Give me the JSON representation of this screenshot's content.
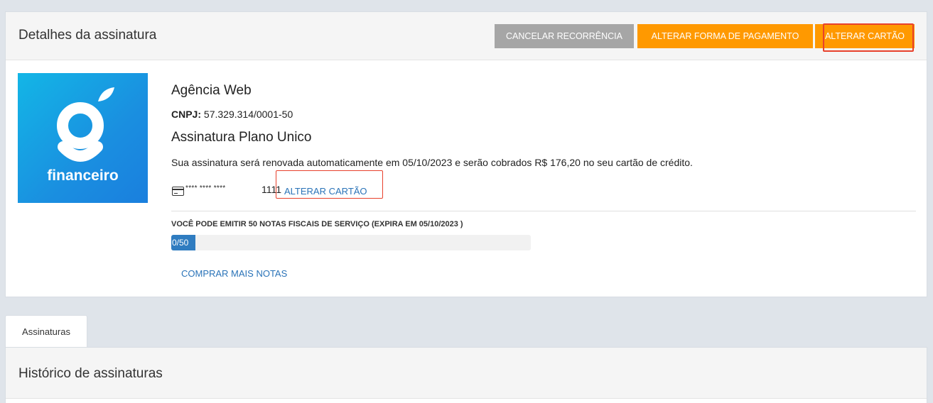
{
  "header": {
    "title": "Detalhes da assinatura",
    "cancel_label": "CANCELAR RECORRÊNCIA",
    "change_payment_label": "ALTERAR FORMA DE PAGAMENTO",
    "change_card_label": "ALTERAR CARTÃO"
  },
  "logo": {
    "text": "financeiro",
    "colors": [
      "#13b6e6",
      "#1a7fde"
    ]
  },
  "company": {
    "name": "Agência Web",
    "cnpj_label": "CNPJ:",
    "cnpj_value": "57.329.314/0001-50",
    "plan": "Assinatura Plano Unico",
    "renewal_text": "Sua assinatura será renovada automaticamente em 05/10/2023 e serão cobrados R$ 176,20 no seu cartão de crédito."
  },
  "card": {
    "icon": "credit-card-icon",
    "masked": "**** **** ****",
    "last4": "1111",
    "change_link": "ALTERAR CARTÃO"
  },
  "notes": {
    "label": "VOCÊ PODE EMITIR 50 NOTAS FISCAIS DE SERVIÇO (EXPIRA EM 05/10/2023 )",
    "progress_text": "0/50",
    "used": 0,
    "total": 50,
    "buy_more": "COMPRAR MAIS NOTAS"
  },
  "tabs": [
    {
      "label": "Assinaturas"
    }
  ],
  "history": {
    "title": "Histórico de assinaturas"
  },
  "colors": {
    "accent": "#ff9900",
    "grey_button": "#a6a6a6",
    "link": "#2a73b8",
    "highlight": "#e8412c",
    "progress": "#2f7cc0"
  }
}
